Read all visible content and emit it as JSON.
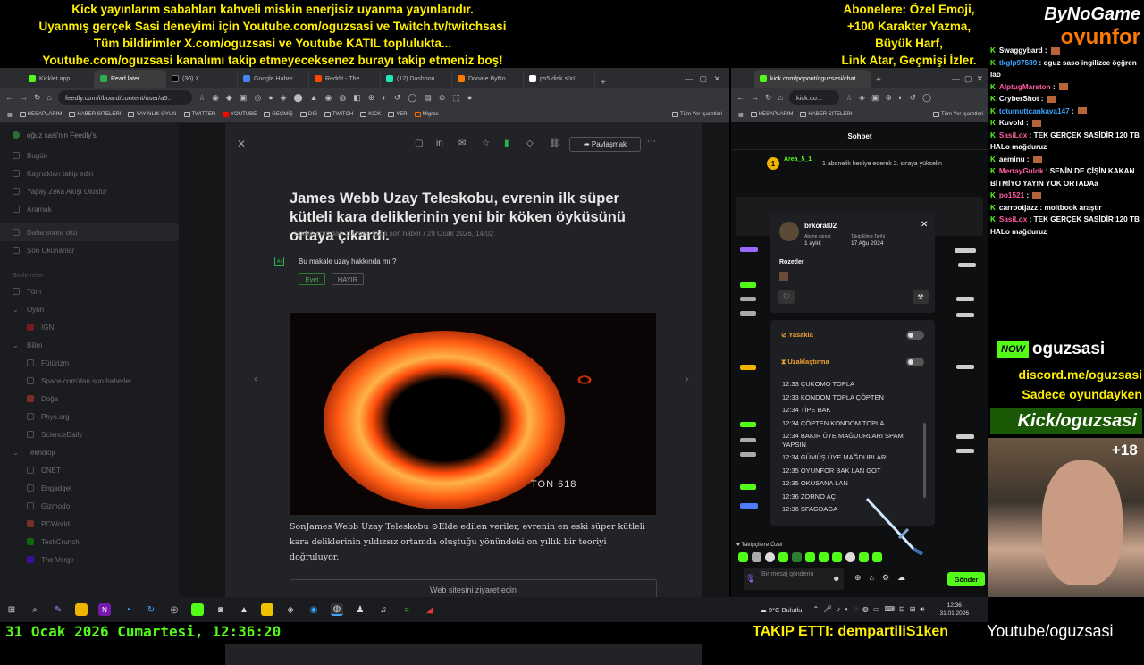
{
  "overlay": {
    "left_lines": [
      "Kick yayınlarım sabahları kahveli miskin enerjisiz uyanma yayınlarıdır.",
      "Uyanmış gerçek Sasi deneyimi için Youtube.com/oguzsasi ve Twitch.tv/twitchsasi",
      "Tüm bildirimler X.com/oguzsasi ve Youtube KATIL topluluktа...",
      "Youtube.com/oguzsasi kanalımı takip etmeyeceksenez burayı takip etmeniz boş!"
    ],
    "right_lines": [
      "Abonelere: Özel Emoji,",
      "+100 Karakter Yazma,",
      "Büyük Harf,",
      "Link Atar, Geçmişi İzler."
    ],
    "logo_top": "ByNoGame",
    "logo_bottom": "oyunfor",
    "date": "31 Ocak 2026 Cumartesi, 12:36:20",
    "follow": "TAKIP ETTI: dempartiliS1ken",
    "youtube": "Youtube/oguzsasi"
  },
  "left_browser": {
    "tabs": [
      "Kicklet.app",
      "Read later",
      "(30) X",
      "Google Haber",
      "Reddit - The",
      "(12) Dashbou",
      "Donate ByNo",
      "ps5 disk sürü"
    ],
    "url": "feedly.com/i/board/content/user/a5...",
    "bookmarks": [
      "HESAPLARIM",
      "HABER SITELERI",
      "YAYINLIK OYUN",
      "TWITTER",
      "YOUTUBE",
      "GEÇMİŞ",
      "DSİ",
      "TWITCH",
      "KICK",
      "YER",
      "Migros",
      "Tüm Yer İşaretleri"
    ]
  },
  "feedly": {
    "user": "oğuz sasi'nin Feedly'si",
    "menu": [
      "Bugün",
      "Kaynakları takip edin",
      "Yapay Zeka Akışı Oluştur",
      "Aramak"
    ],
    "later": [
      "Daha sonra oku",
      "Son Okunanlar"
    ],
    "section": "Beslemeler",
    "all": "Tüm",
    "groups": [
      {
        "name": "Oyun",
        "items": [
          "IGN"
        ]
      },
      {
        "name": "Bilim",
        "items": [
          "Fütürizm",
          "Space.com'dan son haberler.",
          "Doğa",
          "Phys.org",
          "ScienceDaily"
        ]
      },
      {
        "name": "Teknoloji",
        "items": [
          "CNET",
          "Engadget",
          "Gizmodo",
          "PCWorld",
          "TechCrunch",
          "The Verge"
        ]
      }
    ],
    "share": "Paylaşmak",
    "title": "James Webb Uzay Teleskobu, evrenin ilk süper kütleli kara deliklerinin yeni bir köken öyküsünü ortaya çıkardı.",
    "meta": "Space.com'dan 100'den fazla   son haber / 29 Ocak 2026, 14:02",
    "ai_tag": "AI",
    "question": "Bu makale uzay hakkında mı ?",
    "yes": "Evet",
    "no": "HAYIR",
    "image_caption": "TON 618",
    "body": "SonJames Webb Uzay Teleskobu ⊙Elde edilen veriler, evrenin en eski süper kütleli kara deliklerinin yıldızsız ortamda oluştuğu yönündeki on yıllık bir teoriyi doğruluyor.",
    "visit": "Web sitesini ziyaret edin"
  },
  "chat_browser": {
    "tab": "kick.com/popout/oguzsasi/chat",
    "url": "kick.co...",
    "bookmarks": [
      "HESAPLARIM",
      "HABER SITELERI",
      "Tüm Yer İşaretleri"
    ],
    "header": "Sohbet",
    "gift_user": "Area_5_1",
    "gift_text": "1 abonelik hediye ederek 2. sıraya yükselin",
    "popup": {
      "user": "brkoral02",
      "sub_label": "Abone süresi:",
      "sub_value": "1 aylık",
      "follow_label": "Takip Etme Tarihi",
      "follow_value": "17 Ağu 2024",
      "badges": "Rozetler",
      "ban": "Yasakla",
      "timeout": "Uzaklaştırma",
      "log": [
        "12:33 ÇUKOMO TOPLA",
        "12:33 KONDOM TOPLA ÇÖPTEN",
        "12:34 TİPE BAK",
        "12:34 ÇÖPTEN KONDOM TOPLA",
        "12:34 BAKIR ÜYE MAĞDURLARI SPAM YAPSIN",
        "12:34 GÜMÜŞ ÜYE MAĞDURLARI",
        "12:35 OYUNFOR BAK LAN GOT",
        "12:35 OKUSANA LAN",
        "12:36 ZORNO AÇ",
        "12:36 SFAGDAGA"
      ]
    },
    "emote_label": "Takipçilere Özel",
    "input_placeholder": "Bir mesaj gönderin",
    "send": "Gönder"
  },
  "side_chat": [
    {
      "user": "Swaggybard",
      "text": ""
    },
    {
      "user": "tkglp97589",
      "text": "oguz saso ingilizce öçğren lao"
    },
    {
      "user": "AlptugMarston",
      "text": ""
    },
    {
      "user": "CryberShot",
      "text": ""
    },
    {
      "user": "tctumuttcankaya147",
      "text": ""
    },
    {
      "user": "Kuvold",
      "text": ""
    },
    {
      "user": "SasiLox",
      "text": "TEK GERÇEK SASİDİR 120 TB HALo mağduruz"
    },
    {
      "user": "aeminu",
      "text": ""
    },
    {
      "user": "MertayGulok",
      "text": "SENİN DE ÇİŞİN KAKAN BİTMİYO YAYIN YOK ORTADAa"
    },
    {
      "user": "po1521",
      "text": ""
    },
    {
      "user": "carrootjazz",
      "text": "moltbook araştır"
    },
    {
      "user": "SasiLox",
      "text": "TEK GERÇEK SASİDİR 120 TB HALo mağduruz"
    }
  ],
  "brand": {
    "now": "NOW",
    "name": "oguzsasi",
    "discord": "discord.me/oguzsasi",
    "only": "Sadece oyundayken",
    "kick": "Kick/oguzsasi",
    "age": "+18"
  },
  "taskbar": {
    "weather": "9°C  Bulutlu",
    "time": "12:36",
    "date": "31.01.2026"
  }
}
